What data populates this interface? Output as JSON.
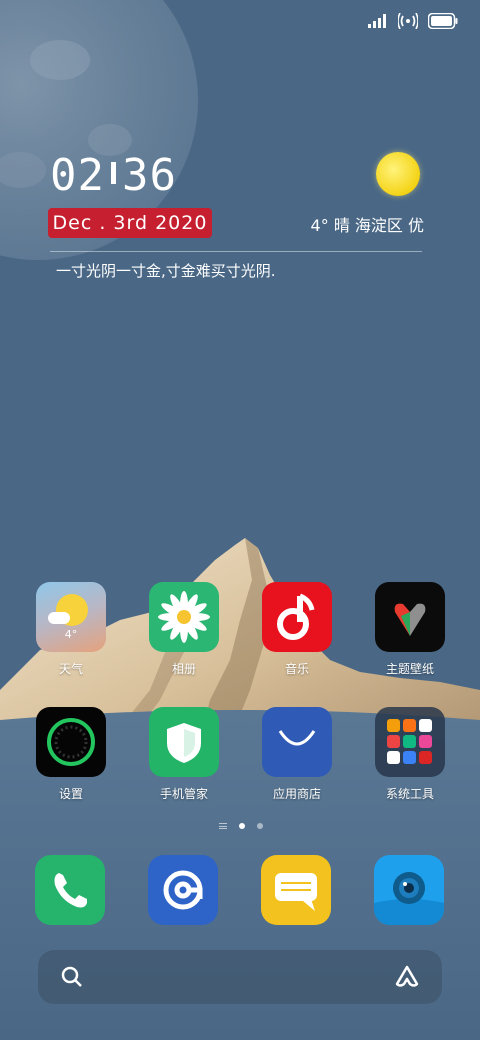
{
  "clock": {
    "hours": "02",
    "minutes": "36"
  },
  "date": "Dec . 3rd  2020",
  "weather": {
    "summary": "4° 晴 海淀区 优"
  },
  "quote": "一寸光阴一寸金,寸金难买寸光阴.",
  "apps_row1": [
    {
      "label": "天气",
      "icon": "weather-icon",
      "temp": "4°"
    },
    {
      "label": "相册",
      "icon": "gallery-icon"
    },
    {
      "label": "音乐",
      "icon": "music-icon"
    },
    {
      "label": "主题壁纸",
      "icon": "themes-icon"
    }
  ],
  "apps_row2": [
    {
      "label": "设置",
      "icon": "settings-icon"
    },
    {
      "label": "手机管家",
      "icon": "security-icon"
    },
    {
      "label": "应用商店",
      "icon": "app-store-icon"
    },
    {
      "label": "系统工具",
      "icon": "folder-icon"
    }
  ],
  "dock": [
    {
      "icon": "phone-icon"
    },
    {
      "icon": "browser-icon"
    },
    {
      "icon": "messages-icon"
    },
    {
      "icon": "camera-icon"
    }
  ],
  "page_indicator": {
    "pages": 2,
    "current": 1
  },
  "colors": {
    "sky": "#4a6886",
    "date_badge": "#c61f2f",
    "sun": "#f4d316"
  }
}
